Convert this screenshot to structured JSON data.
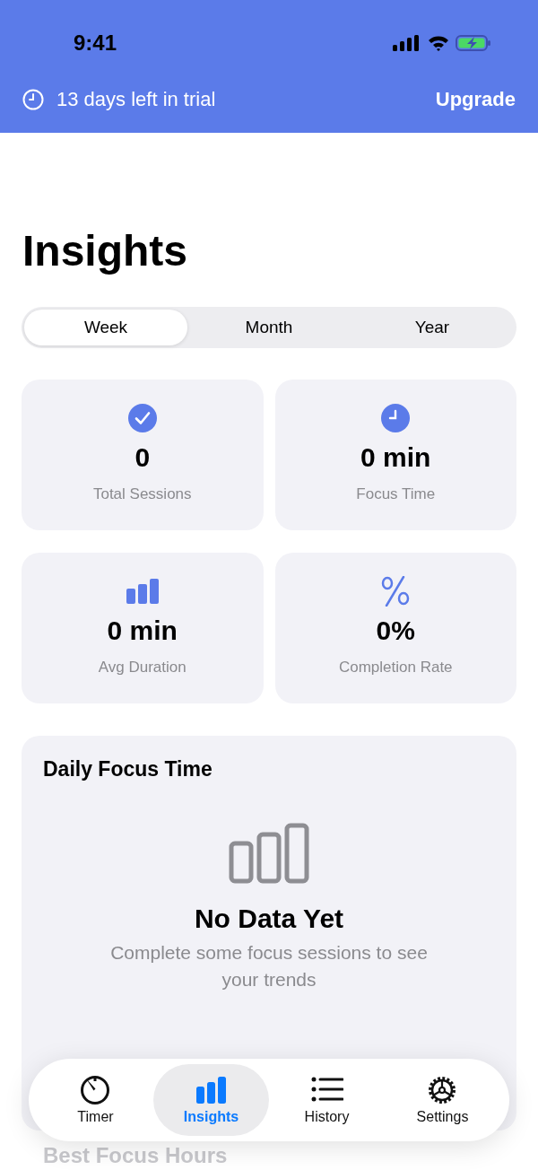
{
  "status_bar": {
    "time": "9:41"
  },
  "trial_banner": {
    "text": "13 days left in trial",
    "action": "Upgrade"
  },
  "title": "Insights",
  "segments": [
    {
      "label": "Week",
      "selected": true
    },
    {
      "label": "Month",
      "selected": false
    },
    {
      "label": "Year",
      "selected": false
    }
  ],
  "stats": [
    {
      "kind": "check",
      "value": "0",
      "label": "Total Sessions"
    },
    {
      "kind": "clock",
      "value": "0 min",
      "label": "Focus Time"
    },
    {
      "kind": "bars",
      "value": "0 min",
      "label": "Avg Duration"
    },
    {
      "kind": "percent",
      "value": "0%",
      "label": "Completion Rate"
    }
  ],
  "daily_focus": {
    "title": "Daily Focus Time",
    "empty_title": "No Data Yet",
    "empty_text": "Complete some focus sessions to see your trends"
  },
  "next_section": {
    "title": "Best Focus Hours"
  },
  "tab_bar": [
    {
      "kind": "timer",
      "label": "Timer",
      "selected": false
    },
    {
      "kind": "insights",
      "label": "Insights",
      "selected": true
    },
    {
      "kind": "history",
      "label": "History",
      "selected": false
    },
    {
      "kind": "settings",
      "label": "Settings",
      "selected": false
    }
  ]
}
